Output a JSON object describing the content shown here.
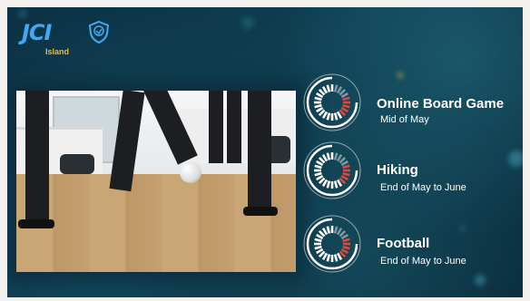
{
  "logo": {
    "text": "JCI",
    "subtitle": "Island",
    "emblem_icon": "jci-shield-icon",
    "colors": {
      "text": "#3fa9f5",
      "subtitle": "#f7b733"
    }
  },
  "photo": {
    "icon": "football-office-photo"
  },
  "events": [
    {
      "title": "Online Board Game",
      "date": "Mid of May",
      "icon": "progress-dial-icon"
    },
    {
      "title": "Hiking",
      "date": "End of May to June",
      "icon": "progress-dial-icon"
    },
    {
      "title": "Football",
      "date": "End of May to June",
      "icon": "progress-dial-icon"
    }
  ],
  "colors": {
    "background": "#0f4052",
    "dial_white": "#ffffff",
    "dial_accent": "#e0483e",
    "title_text": "#ffffff"
  }
}
